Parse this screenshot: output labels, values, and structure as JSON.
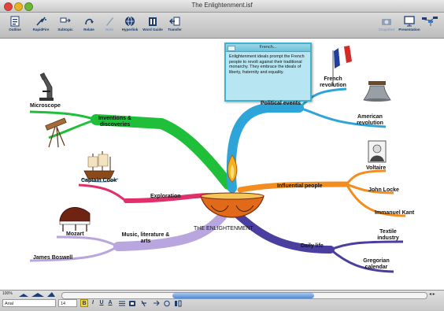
{
  "window": {
    "title": "The Enlightenment.isf"
  },
  "toolbar": {
    "left": [
      {
        "label": "Outline",
        "icon": "outline-icon"
      },
      {
        "label": "RapidFire",
        "icon": "rapidfire-icon"
      },
      {
        "label": "Subtopic",
        "icon": "subtopic-icon"
      },
      {
        "label": "Relate",
        "icon": "relate-icon"
      },
      {
        "label": "Note",
        "icon": "note-icon",
        "disabled": true
      },
      {
        "label": "Hyperlink",
        "icon": "hyperlink-icon"
      },
      {
        "label": "Word Guide",
        "icon": "word-guide-icon"
      },
      {
        "label": "Transfer",
        "icon": "transfer-icon"
      }
    ],
    "right": [
      {
        "label": "Snapshot",
        "icon": "snapshot-icon",
        "disabled": true
      },
      {
        "label": "Presentation",
        "icon": "presentation-icon"
      },
      {
        "label": "",
        "icon": "map-toggle-icon"
      }
    ]
  },
  "map": {
    "central": "THE ENLIGHTENMENT",
    "branches": {
      "inventions": "Inventions & discoveries",
      "microscope": "Microscope",
      "exploration": "Exploration",
      "captain_cook": "Captain Cook",
      "music": "Music, literature & arts",
      "mozart": "Mozart",
      "boswell": "James Boswell",
      "political": "Political events",
      "french": "French revolution",
      "american": "American revolution",
      "influential": "Influential people",
      "voltaire": "Voltaire",
      "locke": "John Locke",
      "kant": "Immanuel Kant",
      "daily": "Daily life",
      "textile": "Textile industry",
      "gregorian": "Gregorian calendar"
    },
    "note": {
      "title": "French...",
      "body": "Enlightenment ideals prompt the French people to revolt against their traditional monarchy. They embrace the ideals of liberty, fraternity and equality."
    },
    "colors": {
      "inventions": "#1fbf3a",
      "exploration": "#e0306a",
      "music": "#b9a6de",
      "political": "#2ea5d8",
      "influential": "#f38d1f",
      "daily": "#4a3f9e"
    }
  },
  "statusbar": {
    "zoom": "100%",
    "font": "Arial",
    "size": "14",
    "format_buttons": [
      "B",
      "I",
      "U",
      "A"
    ]
  }
}
